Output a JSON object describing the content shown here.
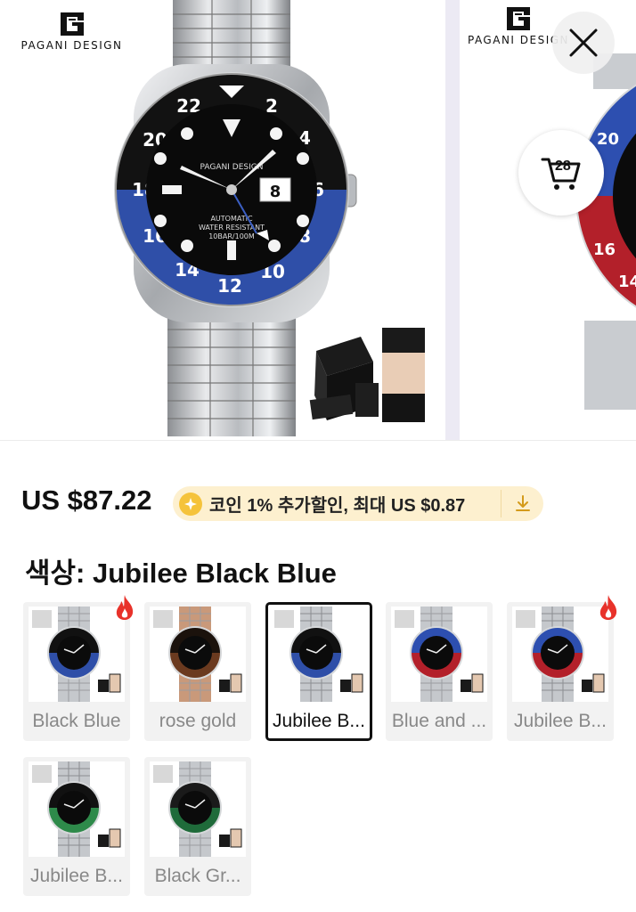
{
  "gallery": {
    "main_image": {
      "brand": "PAGANI DESIGN",
      "alt": "Jubilee Black Blue watch with gift box"
    },
    "next_image": {
      "brand": "PAGANI DESIGN",
      "alt": "Jubilee Blue and Red watch"
    },
    "close_icon": "close-icon",
    "cart": {
      "icon": "cart-icon",
      "count": "28"
    }
  },
  "price": {
    "amount": "US $87.22",
    "coin_promo": "코인 1% 추가할인, 최대 US $0.87",
    "coin_icon": "coin-icon",
    "download_icon": "download-icon"
  },
  "color_selector": {
    "title": "색상: Jubilee Black Blue",
    "options": [
      {
        "label": "Black Blue",
        "bezel_top": "#111111",
        "bezel_bottom": "#2f4fa8",
        "bracelet": "oyster",
        "hot": true,
        "selected": false
      },
      {
        "label": "rose gold",
        "bezel_top": "#1b120c",
        "bezel_bottom": "#6b3a1f",
        "bracelet": "rosegold",
        "hot": false,
        "selected": false
      },
      {
        "label": "Jubilee B...",
        "bezel_top": "#111111",
        "bezel_bottom": "#2f4fa8",
        "bracelet": "jubilee",
        "hot": false,
        "selected": true
      },
      {
        "label": "Blue and ...",
        "bezel_top": "#2d4fb0",
        "bezel_bottom": "#b3202a",
        "bracelet": "oyster",
        "hot": false,
        "selected": false
      },
      {
        "label": "Jubilee B...",
        "bezel_top": "#2d4fb0",
        "bezel_bottom": "#b3202a",
        "bracelet": "jubilee",
        "hot": true,
        "selected": false
      },
      {
        "label": "Jubilee B...",
        "bezel_top": "#111111",
        "bezel_bottom": "#2e8a4a",
        "bracelet": "jubilee",
        "hot": false,
        "selected": false
      },
      {
        "label": "Black Gr...",
        "bezel_top": "#1a1a1a",
        "bezel_bottom": "#1f6b3a",
        "bracelet": "oyster",
        "hot": false,
        "selected": false
      }
    ]
  },
  "colors": {
    "accent_hot": "#e8322a",
    "coin_badge_bg": "#fdf0cf",
    "coin": "#f5c33b"
  }
}
